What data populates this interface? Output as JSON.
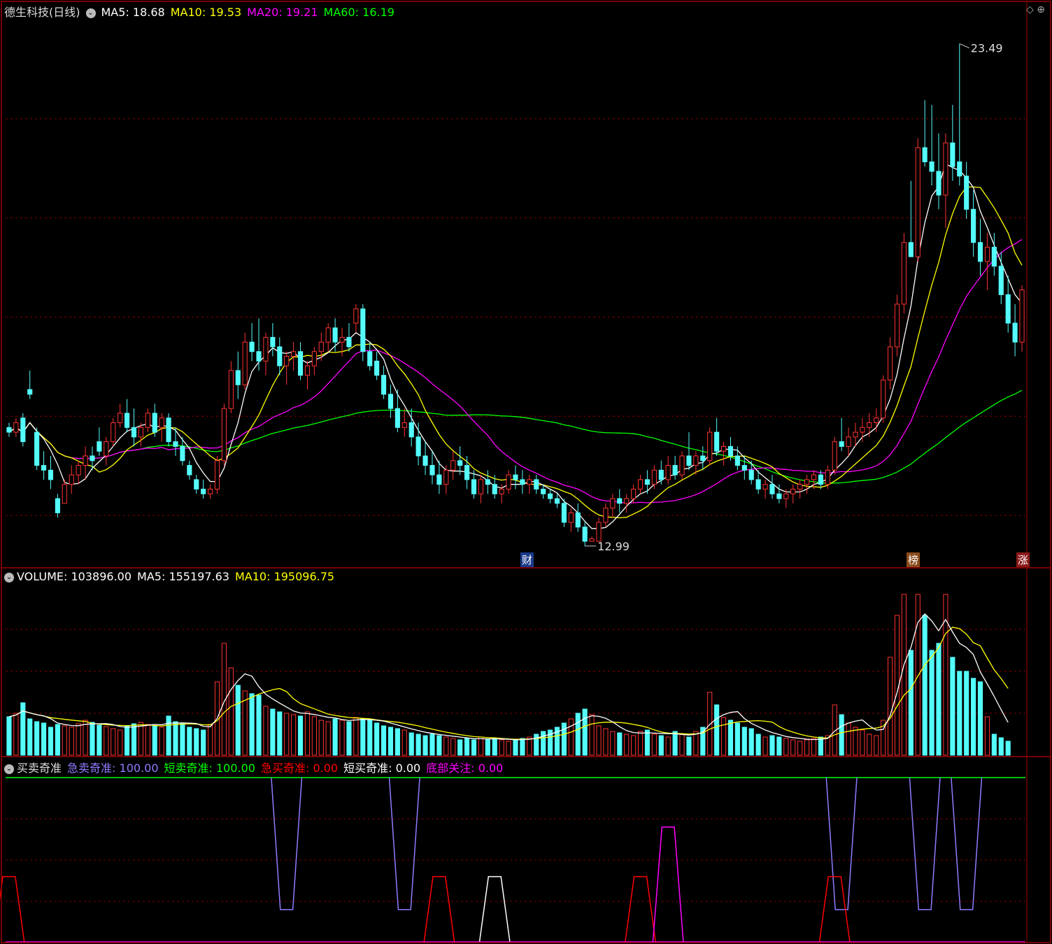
{
  "main_header": {
    "stock": "德生科技(日线)",
    "ma5_label": "MA5",
    "ma5": "18.68",
    "ma10_label": "MA10",
    "ma10": "19.53",
    "ma20_label": "MA20",
    "ma20": "19.21",
    "ma60_label": "MA60",
    "ma60": "16.19"
  },
  "volume_header": {
    "title": "VOLUME",
    "value": "103896.00",
    "ma5_label": "MA5",
    "ma5": "155197.63",
    "ma10_label": "MA10",
    "ma10": "195096.75"
  },
  "indicator_header": {
    "title": "买卖奇准",
    "s1_label": "急卖奇准",
    "s1": "100.00",
    "s2_label": "短卖奇准",
    "s2": "100.00",
    "s3_label": "急买奇准",
    "s3": "0.00",
    "s4_label": "短买奇准",
    "s4": "0.00",
    "s5_label": "底部关注",
    "s5": "0.00"
  },
  "markers": {
    "high_label": "23.49",
    "low_label": "12.99",
    "tag1": "财",
    "tag2": "榜",
    "tag3": "涨"
  },
  "corner": {
    "icons": "◇ ⊕"
  },
  "colors": {
    "up": "#ff3232",
    "down": "#54fcfc",
    "ma5": "#ffffff",
    "ma10": "#ffff00",
    "ma20": "#ff00ff",
    "ma60": "#00ff00",
    "grid": "#800000",
    "border": "#a00000",
    "sig1": "#8f7cff",
    "sig2": "#00ff00",
    "sig3": "#ff0000",
    "sig4": "#ffffff",
    "sig5": "#ff00ff"
  },
  "chart_data": {
    "type": "candlestick",
    "price_range": [
      12.5,
      24.0
    ],
    "candles": [
      [
        15.4,
        15.5,
        15.2,
        15.3
      ],
      [
        15.3,
        15.6,
        15.2,
        15.5
      ],
      [
        15.6,
        15.7,
        15.0,
        15.1
      ],
      [
        16.2,
        16.6,
        16.0,
        16.1
      ],
      [
        15.3,
        15.4,
        14.5,
        14.6
      ],
      [
        14.6,
        14.9,
        14.3,
        14.5
      ],
      [
        14.5,
        14.8,
        14.1,
        14.3
      ],
      [
        13.9,
        14.0,
        13.5,
        13.6
      ],
      [
        13.8,
        14.3,
        13.8,
        14.2
      ],
      [
        14.2,
        14.6,
        14.0,
        14.4
      ],
      [
        14.4,
        14.7,
        14.2,
        14.6
      ],
      [
        14.6,
        15.0,
        14.3,
        14.8
      ],
      [
        14.8,
        15.0,
        14.5,
        14.7
      ],
      [
        15.1,
        15.4,
        14.8,
        14.9
      ],
      [
        14.8,
        15.2,
        14.6,
        15.1
      ],
      [
        15.1,
        15.6,
        15.0,
        15.5
      ],
      [
        15.5,
        15.9,
        15.4,
        15.7
      ],
      [
        15.7,
        16.0,
        15.3,
        15.4
      ],
      [
        15.4,
        15.8,
        15.0,
        15.2
      ],
      [
        15.2,
        15.5,
        15.0,
        15.4
      ],
      [
        15.4,
        15.8,
        15.3,
        15.7
      ],
      [
        15.7,
        15.9,
        15.2,
        15.3
      ],
      [
        15.4,
        15.7,
        15.1,
        15.6
      ],
      [
        15.6,
        15.7,
        15.0,
        15.1
      ],
      [
        15.1,
        15.4,
        14.8,
        15.0
      ],
      [
        15.0,
        15.2,
        14.6,
        14.7
      ],
      [
        14.6,
        14.7,
        14.3,
        14.4
      ],
      [
        14.3,
        14.4,
        14.0,
        14.1
      ],
      [
        14.1,
        14.3,
        13.9,
        14.0
      ],
      [
        14.0,
        14.2,
        13.9,
        14.1
      ],
      [
        14.1,
        14.8,
        14.0,
        14.7
      ],
      [
        14.7,
        15.9,
        14.6,
        15.8
      ],
      [
        15.8,
        16.8,
        15.7,
        16.6
      ],
      [
        16.6,
        17.0,
        16.0,
        16.3
      ],
      [
        16.3,
        17.4,
        16.2,
        17.2
      ],
      [
        17.2,
        17.6,
        16.8,
        17.0
      ],
      [
        17.0,
        17.7,
        16.6,
        16.8
      ],
      [
        16.8,
        17.4,
        16.5,
        17.3
      ],
      [
        17.3,
        17.6,
        16.9,
        17.1
      ],
      [
        17.1,
        17.3,
        16.5,
        16.7
      ],
      [
        16.7,
        17.0,
        16.3,
        16.9
      ],
      [
        16.9,
        17.2,
        16.6,
        17.0
      ],
      [
        17.0,
        17.2,
        16.4,
        16.5
      ],
      [
        16.5,
        16.8,
        16.2,
        16.7
      ],
      [
        16.7,
        17.1,
        16.5,
        17.0
      ],
      [
        17.0,
        17.4,
        16.8,
        17.2
      ],
      [
        17.2,
        17.6,
        17.0,
        17.5
      ],
      [
        17.5,
        17.7,
        17.0,
        17.2
      ],
      [
        17.2,
        17.5,
        16.9,
        17.3
      ],
      [
        17.3,
        17.6,
        17.0,
        17.1
      ],
      [
        17.6,
        18.0,
        17.4,
        17.9
      ],
      [
        17.9,
        18.0,
        16.8,
        17.0
      ],
      [
        17.0,
        17.2,
        16.6,
        16.7
      ],
      [
        16.8,
        17.0,
        16.4,
        16.5
      ],
      [
        16.5,
        16.7,
        16.0,
        16.1
      ],
      [
        16.1,
        16.3,
        15.6,
        15.8
      ],
      [
        15.8,
        16.2,
        15.3,
        15.4
      ],
      [
        15.4,
        15.8,
        15.2,
        15.5
      ],
      [
        15.5,
        15.8,
        15.0,
        15.2
      ],
      [
        15.2,
        15.5,
        14.6,
        14.8
      ],
      [
        14.8,
        15.1,
        14.4,
        14.6
      ],
      [
        14.6,
        14.9,
        14.2,
        14.4
      ],
      [
        14.4,
        14.7,
        14.0,
        14.2
      ],
      [
        14.2,
        14.6,
        14.0,
        14.5
      ],
      [
        14.5,
        14.9,
        14.3,
        14.7
      ],
      [
        14.7,
        15.0,
        14.4,
        14.6
      ],
      [
        14.6,
        14.8,
        14.1,
        14.3
      ],
      [
        14.3,
        14.5,
        13.9,
        14.0
      ],
      [
        14.0,
        14.4,
        13.8,
        14.3
      ],
      [
        14.3,
        14.5,
        14.0,
        14.2
      ],
      [
        14.2,
        14.4,
        13.9,
        14.0
      ],
      [
        14.0,
        14.2,
        13.8,
        14.1
      ],
      [
        14.1,
        14.5,
        14.0,
        14.4
      ],
      [
        14.4,
        14.6,
        14.1,
        14.3
      ],
      [
        14.3,
        14.5,
        14.0,
        14.2
      ],
      [
        14.2,
        14.4,
        14.0,
        14.3
      ],
      [
        14.3,
        14.4,
        14.0,
        14.1
      ],
      [
        14.1,
        14.2,
        13.9,
        14.0
      ],
      [
        14.0,
        14.1,
        13.8,
        13.9
      ],
      [
        13.9,
        14.0,
        13.7,
        13.8
      ],
      [
        13.8,
        13.9,
        13.3,
        13.4
      ],
      [
        13.4,
        13.7,
        13.2,
        13.6
      ],
      [
        13.6,
        13.8,
        13.2,
        13.3
      ],
      [
        13.3,
        13.4,
        12.9,
        13.0
      ],
      [
        13.0,
        13.1,
        12.99,
        13.05
      ],
      [
        13.0,
        13.5,
        12.99,
        13.4
      ],
      [
        13.4,
        13.8,
        13.3,
        13.7
      ],
      [
        13.7,
        14.0,
        13.5,
        13.9
      ],
      [
        13.9,
        14.1,
        13.6,
        13.8
      ],
      [
        13.8,
        14.0,
        13.6,
        13.9
      ],
      [
        13.9,
        14.2,
        13.8,
        14.1
      ],
      [
        14.1,
        14.4,
        14.0,
        14.3
      ],
      [
        14.3,
        14.5,
        14.0,
        14.2
      ],
      [
        14.2,
        14.6,
        14.1,
        14.5
      ],
      [
        14.5,
        14.7,
        14.2,
        14.3
      ],
      [
        14.3,
        14.8,
        14.2,
        14.6
      ],
      [
        14.6,
        14.8,
        14.3,
        14.4
      ],
      [
        14.4,
        14.9,
        14.3,
        14.8
      ],
      [
        14.8,
        15.3,
        14.5,
        14.6
      ],
      [
        14.6,
        14.9,
        14.4,
        14.8
      ],
      [
        14.8,
        15.0,
        14.5,
        14.7
      ],
      [
        14.7,
        15.4,
        14.6,
        15.3
      ],
      [
        15.3,
        15.6,
        14.8,
        14.9
      ],
      [
        14.9,
        15.1,
        14.6,
        15.0
      ],
      [
        15.0,
        15.2,
        14.7,
        14.8
      ],
      [
        14.8,
        15.0,
        14.5,
        14.6
      ],
      [
        14.6,
        14.8,
        14.3,
        14.5
      ],
      [
        14.5,
        14.7,
        14.2,
        14.3
      ],
      [
        14.3,
        14.5,
        14.0,
        14.1
      ],
      [
        14.1,
        14.3,
        13.9,
        14.2
      ],
      [
        14.2,
        14.4,
        13.9,
        14.0
      ],
      [
        14.0,
        14.2,
        13.8,
        13.9
      ],
      [
        13.9,
        14.1,
        13.7,
        14.0
      ],
      [
        14.0,
        14.2,
        13.8,
        14.1
      ],
      [
        14.1,
        14.3,
        13.9,
        14.2
      ],
      [
        14.2,
        14.4,
        14.0,
        14.3
      ],
      [
        14.3,
        14.5,
        14.1,
        14.4
      ],
      [
        14.4,
        14.5,
        14.1,
        14.2
      ],
      [
        14.2,
        14.6,
        14.1,
        14.5
      ],
      [
        14.5,
        15.2,
        14.4,
        15.1
      ],
      [
        15.1,
        15.6,
        14.9,
        15.0
      ],
      [
        15.0,
        15.4,
        14.8,
        15.2
      ],
      [
        15.2,
        15.5,
        15.0,
        15.3
      ],
      [
        15.3,
        15.6,
        15.1,
        15.4
      ],
      [
        15.4,
        15.7,
        15.2,
        15.5
      ],
      [
        15.5,
        15.8,
        15.3,
        15.6
      ],
      [
        15.6,
        16.5,
        15.5,
        16.4
      ],
      [
        16.4,
        17.3,
        16.2,
        17.1
      ],
      [
        17.1,
        18.2,
        16.9,
        18.0
      ],
      [
        18.0,
        19.5,
        17.8,
        19.3
      ],
      [
        19.3,
        20.6,
        19.0,
        19.0
      ],
      [
        19.0,
        21.5,
        18.9,
        21.3
      ],
      [
        21.3,
        22.3,
        20.9,
        21.0
      ],
      [
        21.0,
        22.2,
        20.5,
        20.8
      ],
      [
        20.8,
        21.6,
        20.0,
        20.3
      ],
      [
        20.3,
        21.6,
        19.6,
        21.4
      ],
      [
        21.4,
        22.2,
        20.6,
        20.9
      ],
      [
        21.0,
        23.49,
        20.5,
        20.7
      ],
      [
        20.7,
        21.0,
        19.8,
        20.0
      ],
      [
        20.0,
        20.4,
        19.0,
        19.3
      ],
      [
        19.3,
        19.8,
        18.6,
        18.9
      ],
      [
        18.9,
        19.5,
        18.3,
        19.2
      ],
      [
        19.2,
        19.5,
        18.6,
        18.8
      ],
      [
        18.8,
        19.1,
        18.0,
        18.2
      ],
      [
        18.2,
        18.6,
        17.4,
        17.6
      ],
      [
        17.6,
        18.0,
        16.9,
        17.2
      ],
      [
        17.2,
        18.4,
        17.0,
        18.3
      ]
    ],
    "volume": [
      55,
      60,
      75,
      52,
      48,
      46,
      40,
      44,
      42,
      40,
      45,
      50,
      47,
      43,
      41,
      38,
      36,
      42,
      45,
      47,
      44,
      42,
      40,
      56,
      48,
      45,
      40,
      38,
      36,
      44,
      105,
      160,
      125,
      100,
      92,
      88,
      86,
      70,
      66,
      62,
      60,
      58,
      56,
      62,
      55,
      50,
      48,
      52,
      50,
      48,
      54,
      52,
      50,
      46,
      42,
      40,
      38,
      36,
      32,
      30,
      28,
      30,
      28,
      26,
      24,
      22,
      24,
      22,
      26,
      22,
      24,
      22,
      20,
      22,
      24,
      26,
      30,
      34,
      36,
      40,
      46,
      52,
      60,
      66,
      58,
      42,
      38,
      34,
      32,
      30,
      28,
      34,
      36,
      30,
      28,
      26,
      34,
      30,
      26,
      34,
      40,
      90,
      72,
      54,
      50,
      46,
      40,
      38,
      30,
      26,
      28,
      26,
      24,
      22,
      20,
      22,
      24,
      26,
      28,
      72,
      58,
      46,
      40,
      36,
      30,
      28,
      50,
      140,
      200,
      230,
      150,
      230,
      200,
      150,
      160,
      230,
      140,
      120,
      120,
      110,
      105,
      55,
      30,
      25,
      20
    ],
    "volume_range": [
      0,
      240
    ],
    "indicator_range": [
      0,
      100
    ],
    "signals": {
      "s1_dips": [
        [
          40,
          20
        ],
        [
          57,
          20
        ],
        [
          120,
          20
        ],
        [
          132,
          20
        ],
        [
          138,
          20
        ]
      ],
      "s3_peaks": [
        [
          0,
          40
        ],
        [
          62,
          40
        ],
        [
          91,
          40
        ],
        [
          119,
          40
        ]
      ],
      "s4_peaks": [
        [
          70,
          40
        ]
      ],
      "s5_peaks": [
        [
          95,
          70
        ]
      ]
    }
  }
}
